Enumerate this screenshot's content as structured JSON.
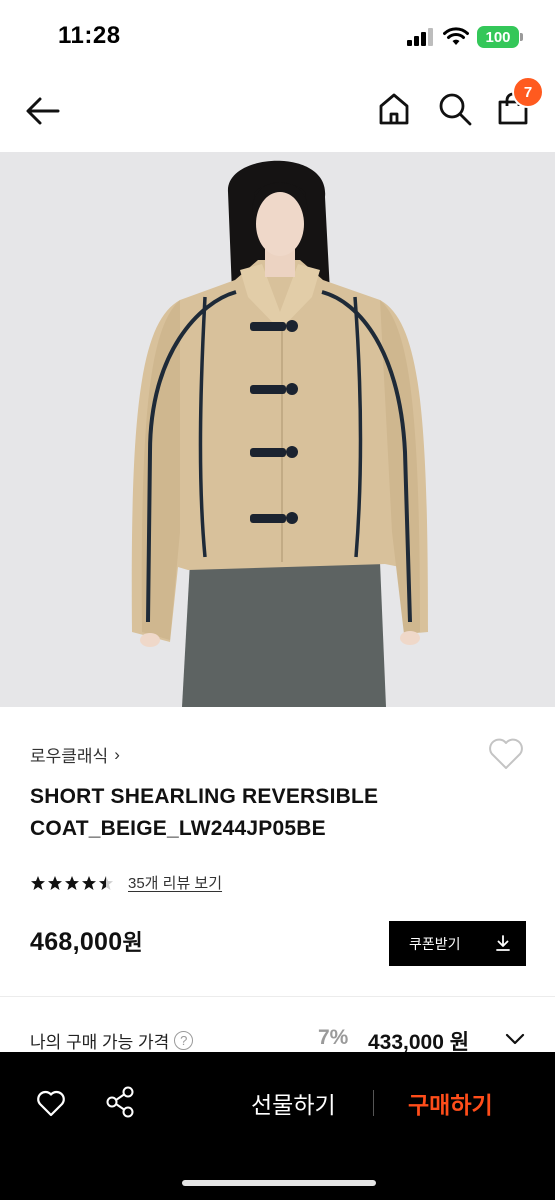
{
  "status_bar": {
    "time": "11:28",
    "battery": "100"
  },
  "nav": {
    "cart_count": "7"
  },
  "product": {
    "brand": "로우클래식",
    "brand_chevron": "›",
    "title": "SHORT SHEARLING REVERSIBLE COAT_BEIGE_LW244JP05BE",
    "rating": 4.5,
    "review_link": "35개 리뷰 보기",
    "price_value": "468,000",
    "price_unit": "원",
    "coupon_label": "쿠폰받기"
  },
  "my_price": {
    "label": "나의 구매 가능 가격",
    "help": "?",
    "discount_rate": "7%",
    "price": "433,000 원"
  },
  "bottom_bar": {
    "gift_label": "선물하기",
    "buy_label": "구매하기"
  },
  "colors": {
    "accent": "#ff4d1a",
    "badge": "#ff5a1f",
    "battery": "#34c759",
    "coat": "#d8c19b"
  }
}
